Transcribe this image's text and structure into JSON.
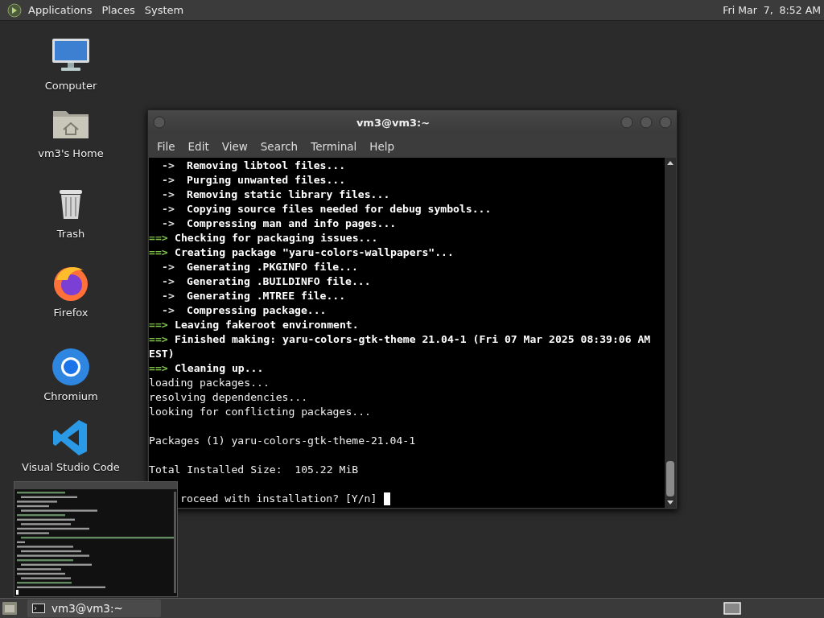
{
  "top_panel": {
    "menus": [
      "Applications",
      "Places",
      "System"
    ],
    "clock": "Fri Mar  7,  8:52 AM"
  },
  "desktop_icons": [
    {
      "kind": "computer",
      "label": "Computer"
    },
    {
      "kind": "home",
      "label": "vm3's Home"
    },
    {
      "kind": "trash",
      "label": "Trash"
    },
    {
      "kind": "firefox",
      "label": "Firefox"
    },
    {
      "kind": "chromium",
      "label": "Chromium"
    },
    {
      "kind": "vscode",
      "label": "Visual Studio Code"
    }
  ],
  "terminal": {
    "title": "vm3@vm3:~",
    "menus": [
      "File",
      "Edit",
      "View",
      "Search",
      "Terminal",
      "Help"
    ],
    "lines": [
      {
        "kind": "step",
        "prefix": "->",
        "text": "Removing libtool files..."
      },
      {
        "kind": "step",
        "prefix": "->",
        "text": "Purging unwanted files..."
      },
      {
        "kind": "step",
        "prefix": "->",
        "text": "Removing static library files..."
      },
      {
        "kind": "step",
        "prefix": "->",
        "text": "Copying source files needed for debug symbols..."
      },
      {
        "kind": "step",
        "prefix": "->",
        "text": "Compressing man and info pages..."
      },
      {
        "kind": "stage",
        "prefix": "==>",
        "text": "Checking for packaging issues..."
      },
      {
        "kind": "stage",
        "prefix": "==>",
        "text": "Creating package \"yaru-colors-wallpapers\"..."
      },
      {
        "kind": "step",
        "prefix": "->",
        "text": "Generating .PKGINFO file..."
      },
      {
        "kind": "step",
        "prefix": "->",
        "text": "Generating .BUILDINFO file..."
      },
      {
        "kind": "step",
        "prefix": "->",
        "text": "Generating .MTREE file..."
      },
      {
        "kind": "step",
        "prefix": "->",
        "text": "Compressing package..."
      },
      {
        "kind": "stage",
        "prefix": "==>",
        "text": "Leaving fakeroot environment."
      },
      {
        "kind": "stage",
        "prefix": "==>",
        "text": "Finished making: yaru-colors-gtk-theme 21.04-1 (Fri 07 Mar 2025 08:39:06 AM"
      },
      {
        "kind": "bold",
        "text": "EST)"
      },
      {
        "kind": "stage",
        "prefix": "==>",
        "text": "Cleaning up..."
      },
      {
        "kind": "plain",
        "text": "loading packages..."
      },
      {
        "kind": "plain",
        "text": "resolving dependencies..."
      },
      {
        "kind": "plain",
        "text": "looking for conflicting packages..."
      },
      {
        "kind": "blank"
      },
      {
        "kind": "plain",
        "text": "Packages (1) yaru-colors-gtk-theme-21.04-1"
      },
      {
        "kind": "blank"
      },
      {
        "kind": "plain",
        "text": "Total Installed Size:  105.22 MiB"
      },
      {
        "kind": "blank"
      },
      {
        "kind": "prompt",
        "text": "roceed with installation? [Y/n]"
      }
    ]
  },
  "taskbar": {
    "tasks": [
      {
        "label": "vm3@vm3:~",
        "selected": false
      }
    ]
  }
}
